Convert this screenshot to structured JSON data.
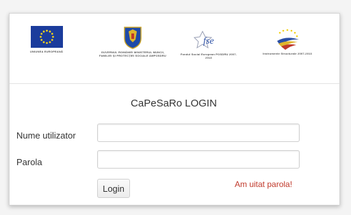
{
  "logos": {
    "eu": {
      "caption": "UNIUNEA EUROPEANĂ"
    },
    "gov": {
      "caption": "GUVERNUL ROMÂNIEI MINISTERUL MUNCII, FAMILIEI ȘI PROTECȚIEI SOCIALE AMPOSDRU"
    },
    "fse": {
      "caption": "Fondul Social European POSDRU 2007-2013",
      "mark": "fse"
    },
    "is": {
      "caption": "Instrumente Structurale 2007-2013"
    }
  },
  "login": {
    "title": "CaPeSaRo LOGIN",
    "username_label": "Nume utilizator",
    "username_value": "",
    "password_label": "Parola",
    "password_value": "",
    "login_button": "Login",
    "forgot_link": "Am uitat parola!"
  },
  "colors": {
    "eu_blue": "#1b3c9c",
    "eu_star": "#f2d21c",
    "forgot_link": "#c0392b"
  }
}
